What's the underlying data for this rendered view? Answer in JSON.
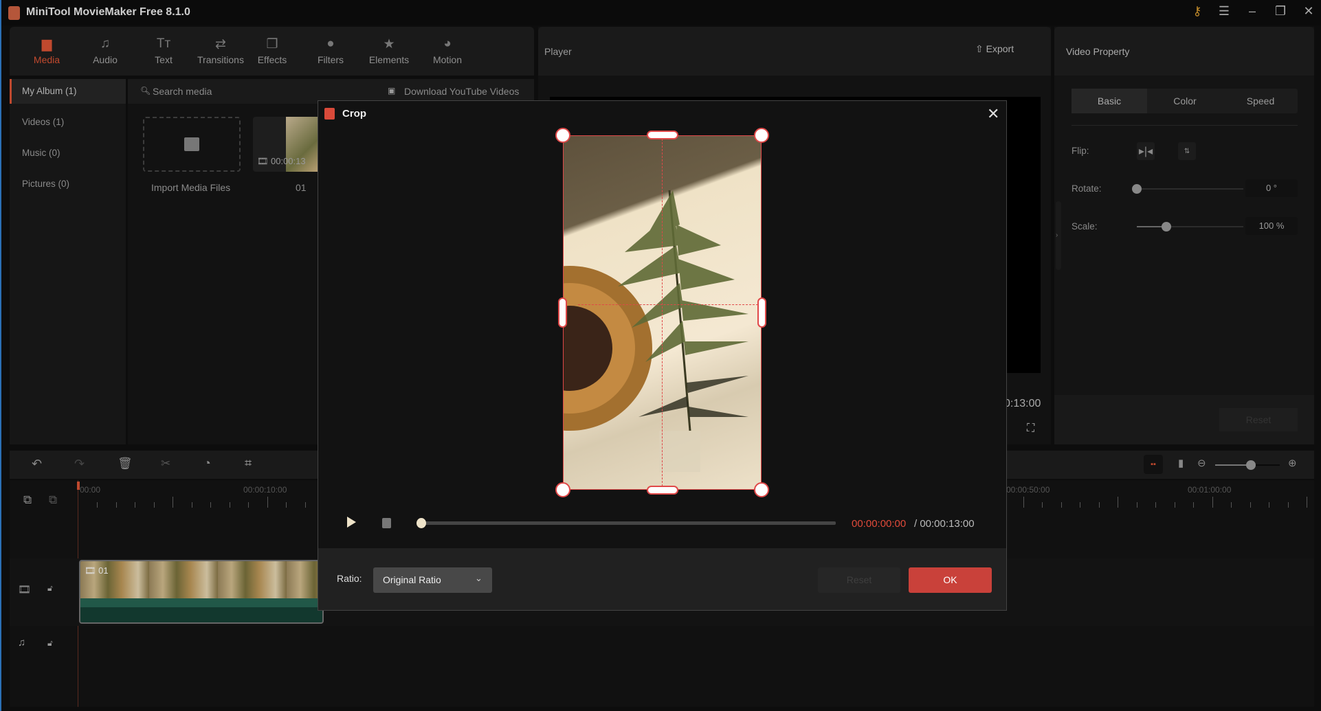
{
  "app": {
    "title": "MiniTool MovieMaker Free 8.1.0",
    "icons": [
      "key-icon",
      "menu-icon",
      "minimize-icon",
      "maximize-icon",
      "close-icon"
    ]
  },
  "toolbar": {
    "items": [
      {
        "label": "Media",
        "icon": "media-folder-icon",
        "active": true
      },
      {
        "label": "Audio",
        "icon": "music-note-icon"
      },
      {
        "label": "Text",
        "icon": "text-icon"
      },
      {
        "label": "Transitions",
        "icon": "transitions-icon"
      },
      {
        "label": "Effects",
        "icon": "effects-icon"
      },
      {
        "label": "Filters",
        "icon": "filters-icon"
      },
      {
        "label": "Elements",
        "icon": "elements-icon"
      },
      {
        "label": "Motion",
        "icon": "motion-icon"
      }
    ]
  },
  "sidebar": {
    "items": [
      {
        "label": "My Album (1)",
        "active": true
      },
      {
        "label": "Videos (1)"
      },
      {
        "label": "Music (0)"
      },
      {
        "label": "Pictures (0)"
      }
    ]
  },
  "media": {
    "search_placeholder": "Search media",
    "download_label": "Download YouTube Videos",
    "import_label": "Import Media Files",
    "clip_duration": "00:00:13",
    "clip_name": "01"
  },
  "player": {
    "title": "Player",
    "export_label": "Export",
    "time_total_partial": "0:13:00"
  },
  "property": {
    "title": "Video Property",
    "tabs": [
      "Basic",
      "Color",
      "Speed"
    ],
    "active_tab": "Basic",
    "flip_label": "Flip:",
    "rotate_label": "Rotate:",
    "rotate_value": "0 °",
    "rotate_fraction": 0,
    "scale_label": "Scale:",
    "scale_value": "100 %",
    "scale_fraction": 0.28,
    "reset_label": "Reset"
  },
  "timeline": {
    "ruler": [
      "00:00",
      "00:00:10:00",
      "00:00:50:00",
      "00:01:00:00"
    ],
    "clip_name": "01",
    "zoom_fraction": 0.55
  },
  "crop": {
    "title": "Crop",
    "current_time": "00:00:00:00",
    "total_time": "/ 00:00:13:00",
    "progress": 0,
    "ratio_label": "Ratio:",
    "ratio_value": "Original Ratio",
    "reset_label": "Reset",
    "ok_label": "OK",
    "accent": "#e04848"
  },
  "colors": {
    "accent": "#d9452f",
    "ok": "#c9413a",
    "track": "#1f5a4a"
  }
}
